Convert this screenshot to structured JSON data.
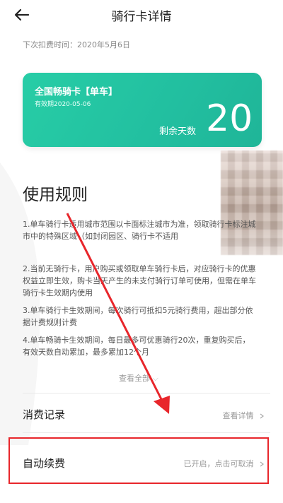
{
  "header": {
    "title": "骑行卡详情"
  },
  "next_deduction": "下次扣费时间：2020年5月6日",
  "card": {
    "title": "全国畅骑卡【单车】",
    "validity": "有效期2020-05-06",
    "days_label": "剩余天数",
    "days_value": "20"
  },
  "rules": {
    "title": "使用规则",
    "items": [
      "1.单车骑行卡适用城市范围以卡面标注城市为准，领取骑行卡标注城市中的特殊区域（如封闭园区、骑行卡不适用",
      "2.当前无骑行卡，用户购买或领取单车骑行卡后，对应骑行卡的优惠权益立即生效，购卡当天产生的未支付骑行订单可使用，但需在单车骑行卡生效期内使用",
      "3.单车骑行卡生效期间，每次骑行可抵扣5元骑行费用，超出部分依据计费规则计费",
      "4.单车畅骑卡生效期间，每日最多可优惠骑行20次，重复购买后，有效天数自动累加，最多累加12个月"
    ],
    "more": "查看全部"
  },
  "consumption": {
    "label": "消费记录",
    "action": "查看详情"
  },
  "auto_renew": {
    "label": "自动续费",
    "action": "已开启，点击可取消"
  },
  "colors": {
    "card": "#27cda6",
    "highlight": "#e8262b"
  }
}
